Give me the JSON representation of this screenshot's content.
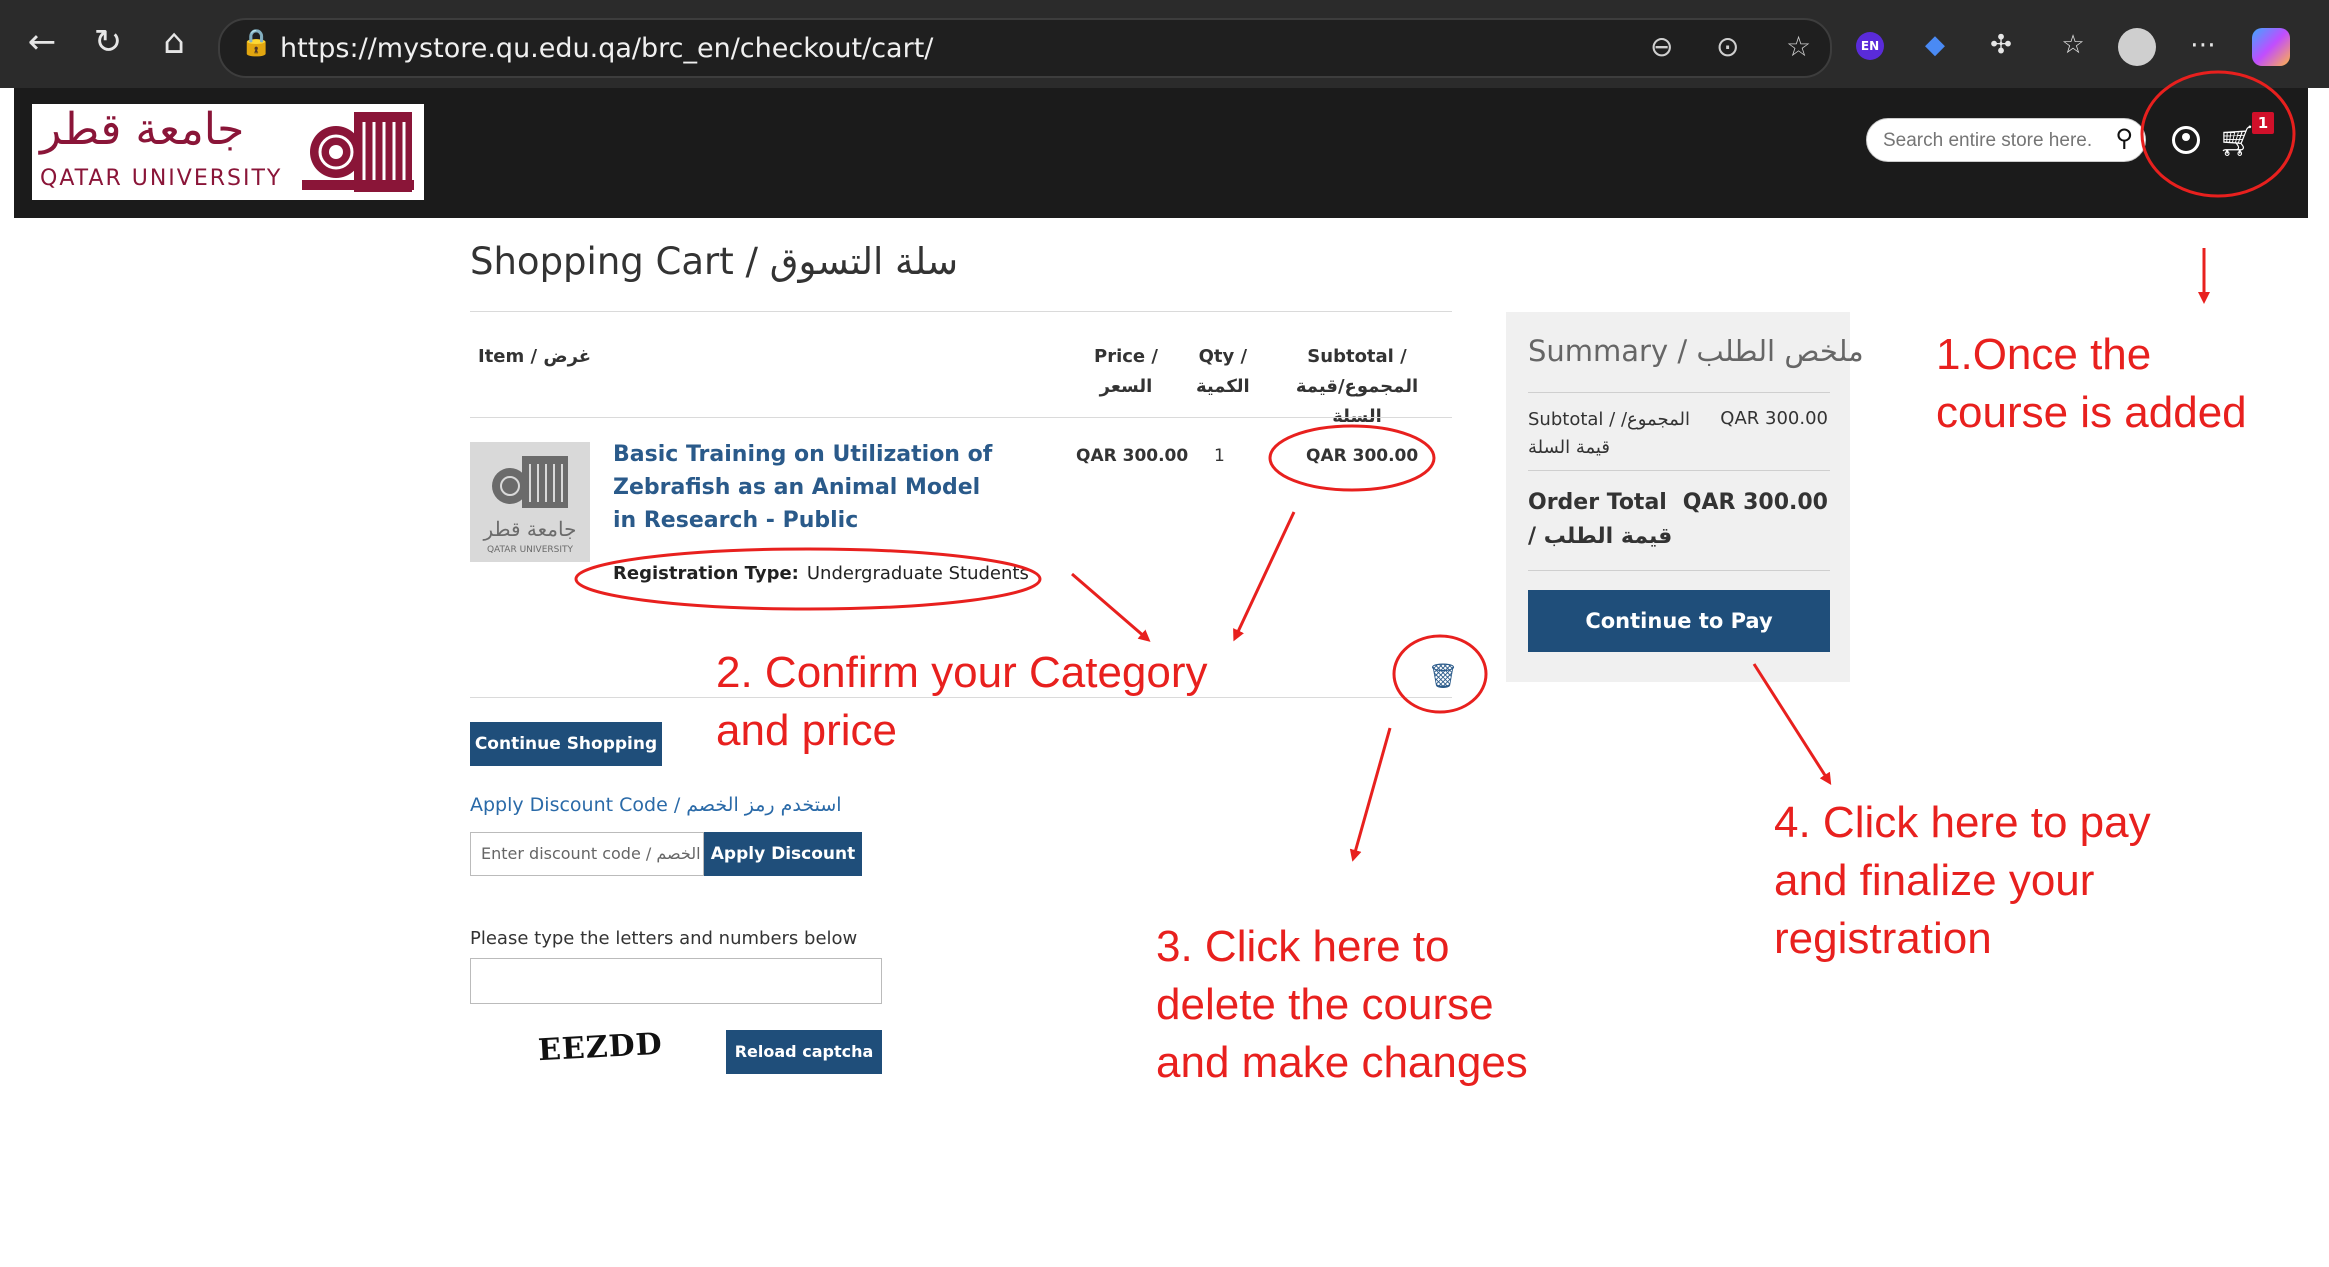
{
  "browser": {
    "url": "https://mystore.qu.edu.qa/brc_en/checkout/cart/",
    "ext_en_label": "EN"
  },
  "header": {
    "logo_ar": "جامعة قطر",
    "logo_en": "QATAR UNIVERSITY",
    "search_placeholder": "Search entire store here...",
    "cart_count": "1"
  },
  "cart": {
    "title": "Shopping Cart / سلة التسوق",
    "columns": {
      "item": "Item / غرض",
      "price": [
        "Price /",
        "السعر"
      ],
      "qty": [
        "Qty /",
        "الكمية"
      ],
      "subtotal": [
        "Subtotal /",
        "المجموع/قيمة السلة"
      ]
    },
    "item": {
      "name": "Basic Training on Utilization of Zebrafish as an Animal Model in Research - Public",
      "price": "QAR 300.00",
      "qty": "1",
      "subtotal": "QAR 300.00",
      "registration_label": "Registration Type:",
      "registration_value": "Undergraduate Students",
      "thumb_ar": "جامعة قطر",
      "thumb_en": "QATAR UNIVERSITY"
    },
    "continue_shopping": "Continue Shopping",
    "discount_link": "Apply Discount Code / استخدم رمز الخصم",
    "discount_placeholder": "Enter discount code / الخصم",
    "apply_discount": "Apply Discount",
    "captcha_label": "Please type the letters and numbers below",
    "captcha_text": "EEZDD",
    "reload_captcha": "Reload captcha"
  },
  "summary": {
    "title": "Summary / ملخص الطلب",
    "subtotal_label": "Subtotal / المجموع/ قيمة السلة",
    "subtotal_value": "QAR 300.00",
    "order_total_label": "Order Total / قيمة الطلب",
    "order_total_value": "QAR 300.00",
    "continue_to_pay": "Continue to Pay"
  },
  "annotations": {
    "step1": [
      "1.Once the",
      "course is added"
    ],
    "step2": [
      "2. Confirm your Category",
      "and price"
    ],
    "step3": [
      "3. Click here to",
      "delete the course",
      "and make changes"
    ],
    "step4": [
      "4. Click here to pay",
      "and finalize your",
      "registration"
    ],
    "color": "#e8201e"
  },
  "colors": {
    "accent": "#1f4e7a",
    "link": "#2a5a8a",
    "brand": "#8a1538",
    "header_bg": "#1b1b1b"
  }
}
